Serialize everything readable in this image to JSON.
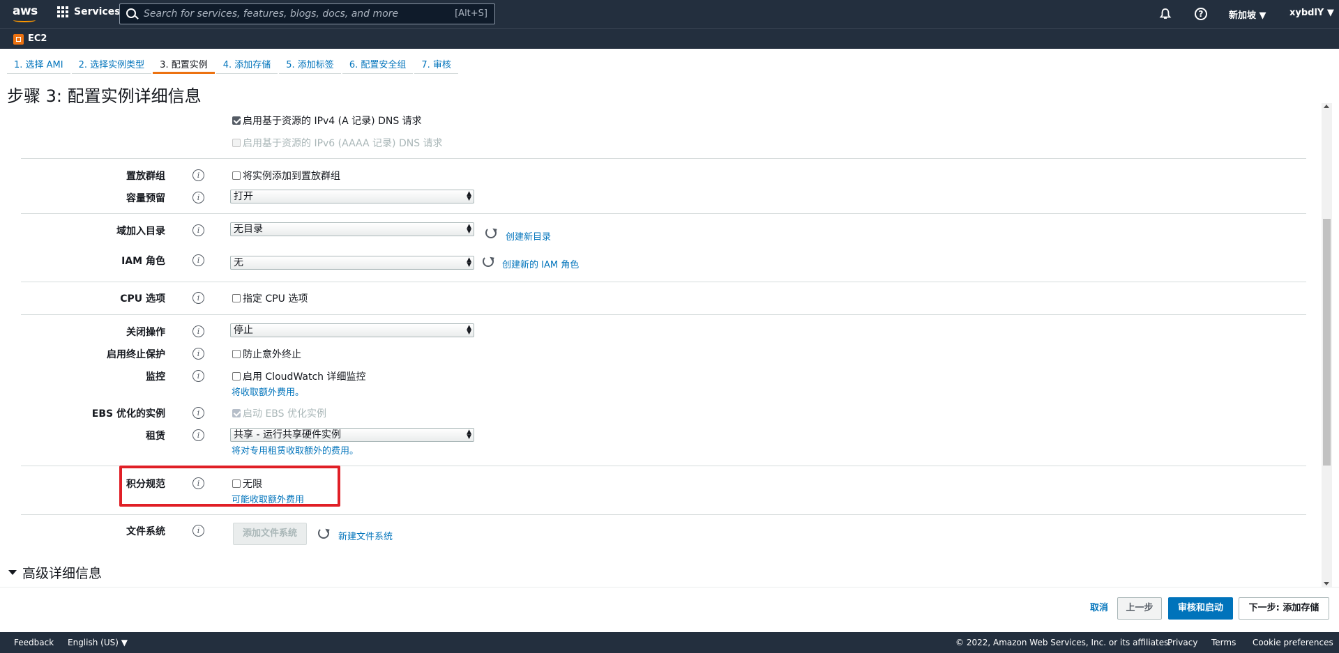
{
  "header": {
    "logo_text": "aws",
    "services_label": "Services",
    "search_placeholder": "Search for services, features, blogs, docs, and more",
    "search_shortcut": "[Alt+S]",
    "region": "新加坡 ▼",
    "user": "xybdlY ▼",
    "service_name": "EC2"
  },
  "steps": [
    {
      "label": "1. 选择 AMI",
      "active": false
    },
    {
      "label": "2. 选择实例类型",
      "active": false
    },
    {
      "label": "3. 配置实例",
      "active": true
    },
    {
      "label": "4. 添加存储",
      "active": false
    },
    {
      "label": "5. 添加标签",
      "active": false
    },
    {
      "label": "6. 配置安全组",
      "active": false
    },
    {
      "label": "7. 审核",
      "active": false
    }
  ],
  "page_title": "步骤 3: 配置实例详细信息",
  "form": {
    "dns_ipv4": "启用基于资源的 IPv4 (A 记录) DNS 请求",
    "dns_ipv6": "启用基于资源的 IPv6 (AAAA 记录) DNS 请求",
    "placement_group_label": "置放群组",
    "placement_group_checkbox": "将实例添加到置放群组",
    "capacity_label": "容量预留",
    "capacity_value": "打开",
    "domain_label": "域加入目录",
    "domain_value": "无目录",
    "domain_link": "创建新目录",
    "iam_label": "IAM 角色",
    "iam_value": "无",
    "iam_link": "创建新的 IAM 角色",
    "cpu_label": "CPU 选项",
    "cpu_checkbox": "指定 CPU 选项",
    "shutdown_label": "关闭操作",
    "shutdown_value": "停止",
    "termination_label": "启用终止保护",
    "termination_checkbox": "防止意外终止",
    "monitoring_label": "监控",
    "monitoring_checkbox": "启用 CloudWatch 详细监控",
    "monitoring_note": "将收取额外费用。",
    "ebs_label": "EBS 优化的实例",
    "ebs_checkbox": "启动 EBS 优化实例",
    "tenancy_label": "租赁",
    "tenancy_value": "共享 - 运行共享硬件实例",
    "tenancy_note": "将对专用租赁收取额外的费用。",
    "credit_label": "积分规范",
    "credit_checkbox": "无限",
    "credit_note": "可能收取额外费用",
    "fs_label": "文件系统",
    "fs_button": "添加文件系统",
    "fs_link": "新建文件系统",
    "advanced": "高级详细信息",
    "info_glyph": "i"
  },
  "actions": {
    "cancel": "取消",
    "prev": "上一步",
    "review": "审核和启动",
    "next": "下一步: 添加存储"
  },
  "footer": {
    "feedback": "Feedback",
    "language": "English (US) ▼",
    "copyright": "© 2022, Amazon Web Services, Inc. or its affiliates.",
    "privacy": "Privacy",
    "terms": "Terms",
    "cookies": "Cookie preferences"
  },
  "colors": {
    "nav_bg": "#232f3e",
    "link": "#0073bb",
    "accent": "#ec7211",
    "primary_button": "#0073bb",
    "highlight_box": "#e01f26"
  }
}
